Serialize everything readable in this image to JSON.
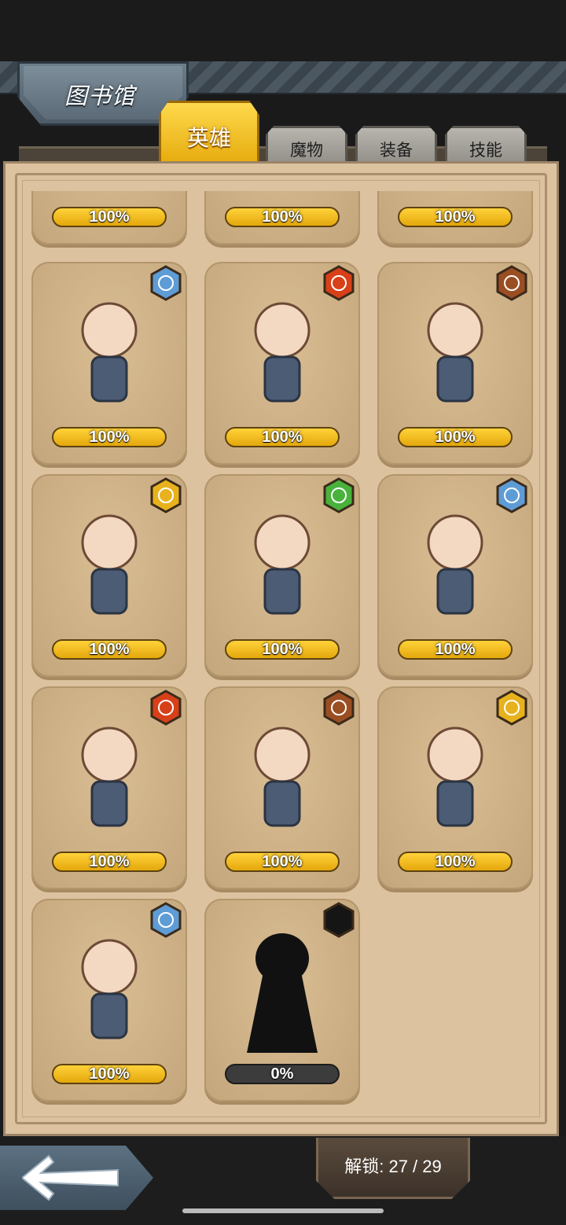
{
  "page": {
    "title": "图书馆"
  },
  "tabs": [
    {
      "label": "英雄",
      "active": true
    },
    {
      "label": "魔物",
      "active": false
    },
    {
      "label": "装备",
      "active": false
    },
    {
      "label": "技能",
      "active": false
    }
  ],
  "cards": [
    {
      "hero_icon": "hero-portrait-icon",
      "progress": "100%",
      "element": "none"
    },
    {
      "hero_icon": "hero-portrait-icon",
      "progress": "100%",
      "element": "none"
    },
    {
      "hero_icon": "hero-portrait-icon",
      "progress": "100%",
      "element": "none"
    },
    {
      "hero_icon": "elf-spear-hero-icon",
      "progress": "100%",
      "element": "water"
    },
    {
      "hero_icon": "red-hair-archer-hero-icon",
      "progress": "100%",
      "element": "fire"
    },
    {
      "hero_icon": "gunner-girl-hero-icon",
      "progress": "100%",
      "element": "earth"
    },
    {
      "hero_icon": "silver-hair-sword-hero-icon",
      "progress": "100%",
      "element": "light"
    },
    {
      "hero_icon": "fox-ear-mage-hero-icon",
      "progress": "100%",
      "element": "wind"
    },
    {
      "hero_icon": "blue-sword-hero-icon",
      "progress": "100%",
      "element": "water"
    },
    {
      "hero_icon": "trident-warrior-hero-icon",
      "progress": "100%",
      "element": "fire"
    },
    {
      "hero_icon": "scholar-girl-hero-icon",
      "progress": "100%",
      "element": "earth"
    },
    {
      "hero_icon": "twin-tail-scythe-hero-icon",
      "progress": "100%",
      "element": "light"
    },
    {
      "hero_icon": "magician-top-hat-hero-icon",
      "progress": "100%",
      "element": "water"
    },
    {
      "hero_icon": "locked-silhouette-icon",
      "progress": "0%",
      "element": "locked"
    }
  ],
  "element_colors": {
    "water": "#5e9cd6",
    "fire": "#d8401a",
    "earth": "#9a4e22",
    "light": "#e8b21e",
    "wind": "#49b23c",
    "locked": "#151515"
  },
  "footer": {
    "unlock_text": "解锁: 27 / 29",
    "back_icon": "back-arrow-icon"
  }
}
